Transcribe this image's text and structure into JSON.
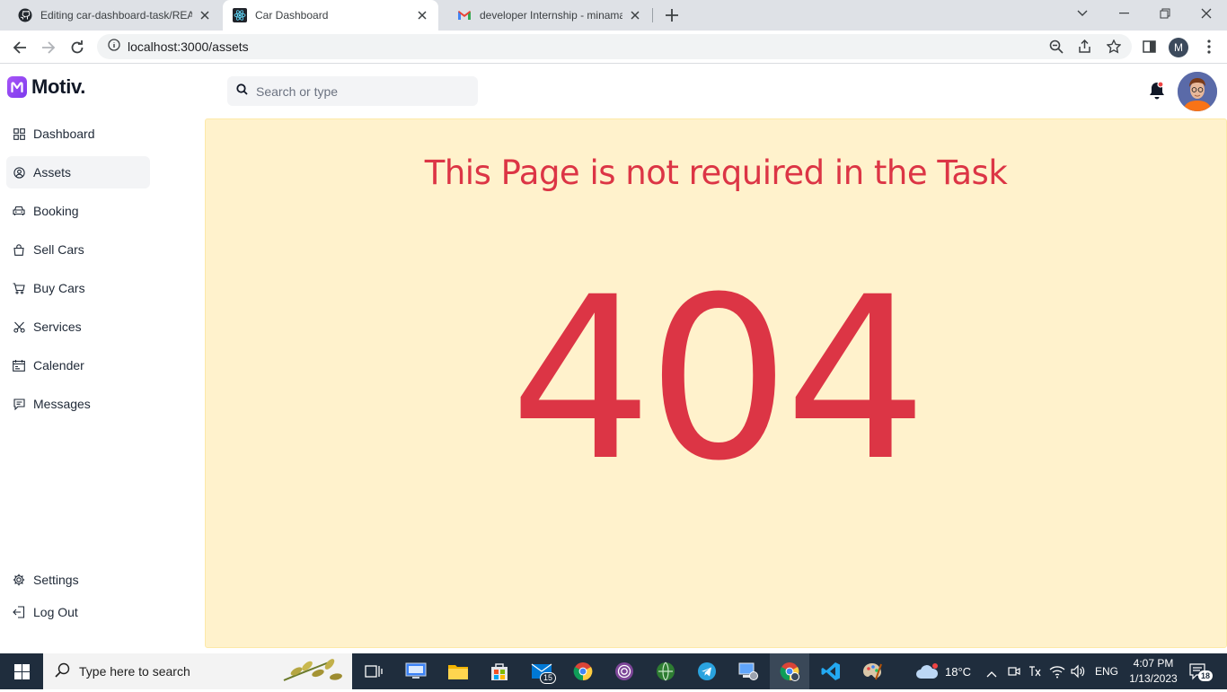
{
  "browser": {
    "tabs": [
      {
        "title": "Editing car-dashboard-task/READ",
        "icon": "github-icon"
      },
      {
        "title": "Car Dashboard",
        "icon": "react-icon",
        "active": true
      },
      {
        "title": "developer Internship - minamag",
        "icon": "gmail-icon"
      }
    ],
    "url": "localhost:3000/assets",
    "profile_initial": "M"
  },
  "app": {
    "brand": "Motiv.",
    "search_placeholder": "Search or type",
    "nav": [
      {
        "label": "Dashboard",
        "icon": "grid-icon"
      },
      {
        "label": "Assets",
        "icon": "assets-icon",
        "active": true
      },
      {
        "label": "Booking",
        "icon": "car-icon"
      },
      {
        "label": "Sell Cars",
        "icon": "bag-icon"
      },
      {
        "label": "Buy Cars",
        "icon": "cart-icon"
      },
      {
        "label": "Services",
        "icon": "scissors-icon"
      },
      {
        "label": "Calender",
        "icon": "calendar-icon"
      },
      {
        "label": "Messages",
        "icon": "message-icon"
      }
    ],
    "nav_bottom": [
      {
        "label": "Settings",
        "icon": "gear-icon"
      },
      {
        "label": "Log Out",
        "icon": "logout-icon"
      }
    ]
  },
  "content": {
    "heading": "This Page is not required in the Task",
    "code": "404",
    "background_color": "#fff2cc",
    "text_color": "#dc3545"
  },
  "taskbar": {
    "search_placeholder": "Type here to search",
    "mail_badge": "15",
    "weather": "18°C",
    "language": "ENG",
    "time": "4:07 PM",
    "date": "1/13/2023",
    "notifications": "18"
  }
}
